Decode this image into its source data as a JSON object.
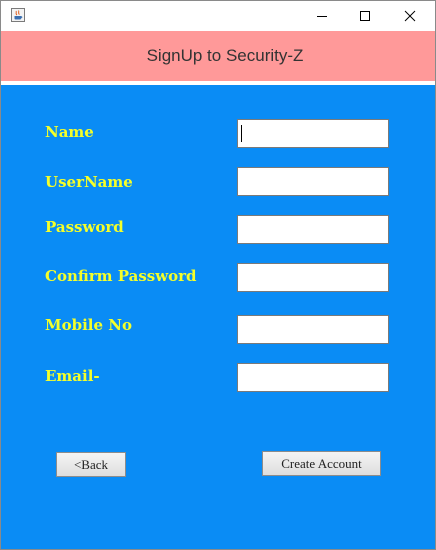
{
  "window": {
    "minimize_icon": "minimize-icon",
    "maximize_icon": "maximize-icon",
    "close_icon": "close-icon",
    "app_icon": "java-app-icon"
  },
  "header": {
    "title": "SignUp to Security-Z",
    "background_color": "#ff9999"
  },
  "form": {
    "background_color": "#0a8cf5",
    "label_color": "#f5ff2a",
    "fields": [
      {
        "label": "Name",
        "value": "",
        "focused": true
      },
      {
        "label": "UserName",
        "value": ""
      },
      {
        "label": "Password",
        "value": ""
      },
      {
        "label": "Confirm Password",
        "value": ""
      },
      {
        "label": "Mobile No",
        "value": ""
      },
      {
        "label": "Email-",
        "value": ""
      }
    ]
  },
  "buttons": {
    "back_label": "<Back",
    "create_label": "Create Account"
  }
}
